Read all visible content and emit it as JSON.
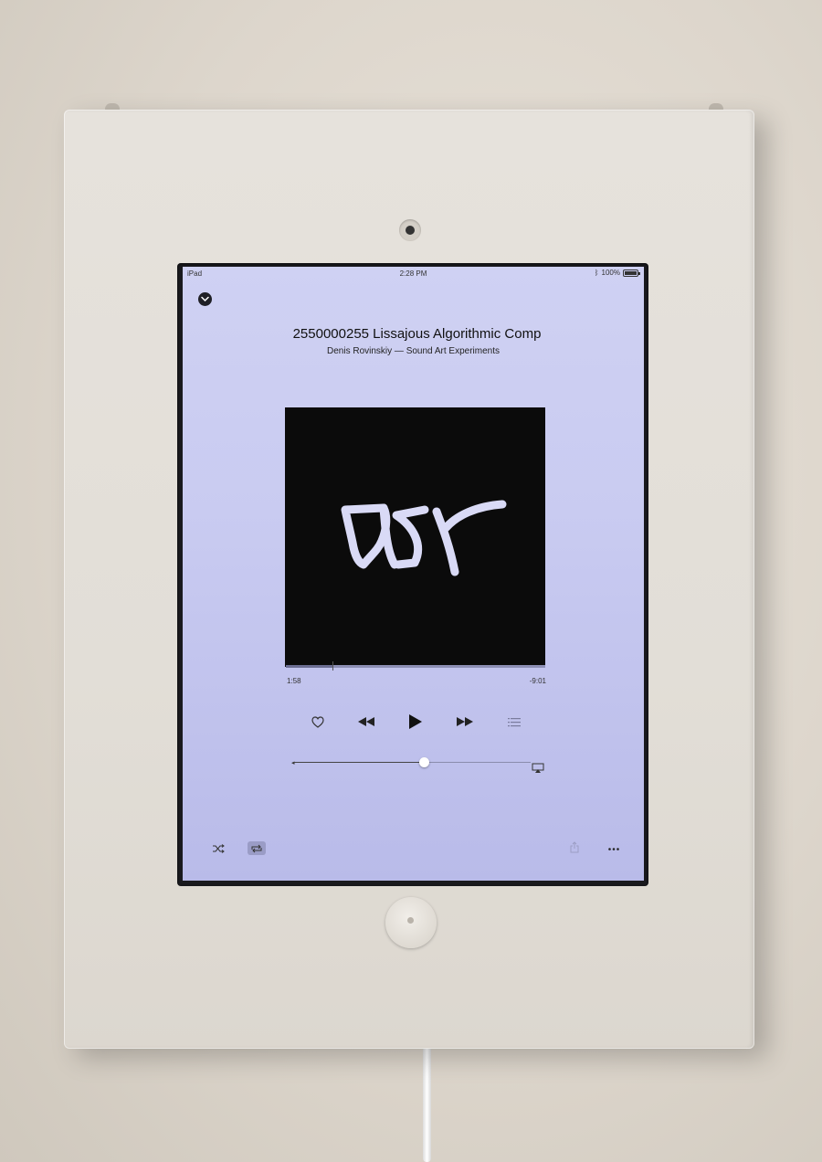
{
  "status_bar": {
    "device": "iPad",
    "time": "2:28 PM",
    "battery": "100%"
  },
  "now_playing": {
    "title": "2550000255 Lissajous Algorithmic Comp",
    "subtitle": "Denis Rovinskiy — Sound Art Experiments",
    "artwork_text": "dsr",
    "elapsed": "1:58",
    "remaining": "-9:01",
    "progress_fraction": 0.18,
    "volume_fraction": 0.55
  },
  "controls": {
    "love": "heart-icon",
    "previous": "rewind-icon",
    "play": "play-icon",
    "next": "fast-forward-icon",
    "up_next": "list-icon"
  },
  "bottom_bar": {
    "shuffle": "shuffle-icon",
    "repeat": "repeat-icon",
    "share": "share-icon",
    "more": "more-icon"
  },
  "colors": {
    "screen_background": "#c9cbf1",
    "artwork_background": "#0b0b0b",
    "artwork_stroke": "#d9daf6"
  }
}
